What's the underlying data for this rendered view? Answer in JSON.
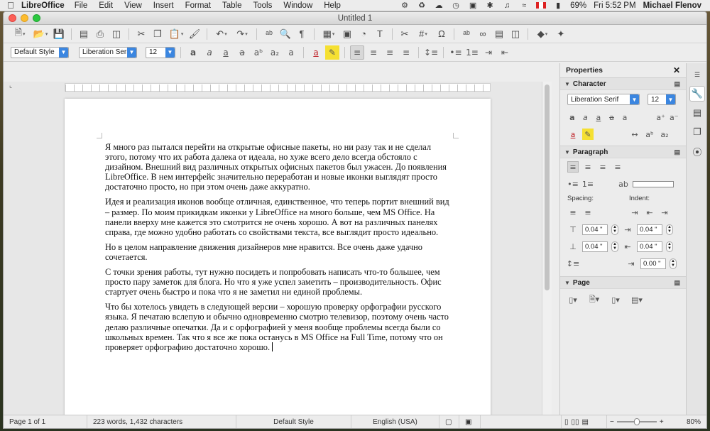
{
  "menubar": {
    "app_name": "LibreOffice",
    "items": [
      "File",
      "Edit",
      "View",
      "Insert",
      "Format",
      "Table",
      "Tools",
      "Window",
      "Help"
    ],
    "battery": "69%",
    "clock": "Fri 5:52 PM",
    "user": "Michael Flenov"
  },
  "window": {
    "title": "Untitled 1"
  },
  "format": {
    "paragraph_style": "Default Style",
    "font_name": "Liberation Serif",
    "font_size": "12"
  },
  "document": {
    "paragraphs": [
      "Я много раз пытался перейти на открытые офисные пакеты, но ни разу так и не сделал этого, потому что их работа далека от идеала, но хуже всего дело всегда обстояло с дизайном. Внешний вид различных открытых офисных пакетов был ужасен. До появления LibreOffice. В нем интерфейс значительно переработан и новые иконки выглядят просто достаточно просто, но при этом очень даже аккуратно.",
      "Идея и реализация иконов вообще отличная, единственное, что теперь портит внешний вид – размер. По моим прикидкам иконки у LibreOffice на много больше, чем MS Office. На панели вверху мне кажется это смотрится не очень хорошо. А вот на различных панелях справа, где можно удобно работать со свойствами текста, все выглядит просто идеально.",
      "Но в целом направление движения дизайнеров мне нравится. Все очень даже удачно сочетается.",
      "С точки зрения работы, тут нужно посидеть и попробовать написать что-то большее, чем просто пару заметок для блога. Но что я уже успел заметить – производительность. Офис стартует очень быстро и пока что я не заметил ни единой проблемы.",
      "Что бы хотелось увидеть в следующей версии – хорошую проверку орфографии русского языка. Я печатаю вслепую и обычно одновременно смотрю телевизор, поэтому очень часто делаю различные опечатки. Да и с орфографией у меня вообще проблемы всегда были со школьных времен. Так что я все же пока останусь в MS Office на Full Time, потому что он проверяет орфографию достаточно хорошо."
    ]
  },
  "sidebar": {
    "title": "Properties",
    "character": {
      "heading": "Character",
      "font_name": "Liberation Serif",
      "font_size": "12"
    },
    "paragraph": {
      "heading": "Paragraph",
      "spacing_label": "Spacing:",
      "indent_label": "Indent:",
      "above_spacing": "0.04 \"",
      "below_spacing": "0.04 \"",
      "before_indent": "0.04 \"",
      "after_indent": "0.04 \"",
      "first_line_indent": "0.00 \""
    },
    "page": {
      "heading": "Page"
    }
  },
  "status": {
    "page": "Page 1 of 1",
    "words": "223 words, 1,432 characters",
    "style": "Default Style",
    "language": "English (USA)",
    "zoom": "80%"
  },
  "colors": {
    "accent": "#3b86e0",
    "font_color": "#c0262c",
    "highlight": "#f5e032"
  }
}
